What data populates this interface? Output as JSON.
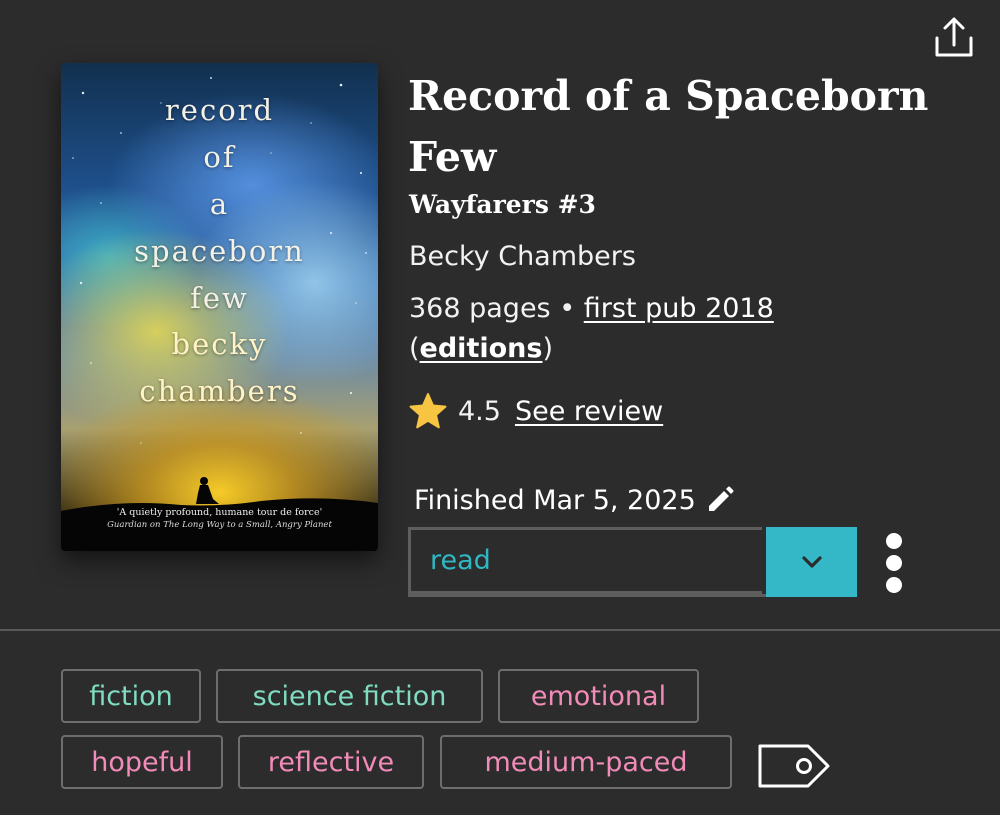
{
  "book": {
    "title": "Record of a Spaceborn Few",
    "series": "Wayfarers #3",
    "author": "Becky Chambers",
    "pages": "368 pages",
    "separator": "•",
    "first_pub": "first pub 2018",
    "editions_open": "(",
    "editions_label": "editions",
    "editions_close": ")"
  },
  "cover": {
    "title_lines": [
      "record",
      "of",
      "a",
      "spaceborn",
      "few"
    ],
    "author_lines": [
      "becky",
      "chambers"
    ],
    "quote": "'A quietly profound, humane tour de force'",
    "credit": "Guardian on The Long Way to a Small, Angry Planet"
  },
  "rating": {
    "value": "4.5",
    "review_label": "See review",
    "star_color": "#f7c542"
  },
  "status": {
    "finished_text": "Finished Mar 5, 2025",
    "selected": "read",
    "accent_color": "#34b7c6"
  },
  "tags": {
    "genres": [
      "fiction",
      "science fiction"
    ],
    "moods": [
      "emotional",
      "hopeful",
      "reflective",
      "medium-paced"
    ],
    "genre_color": "#7fdcc0",
    "mood_color": "#f28bb8"
  },
  "icons": {
    "share": "share-icon",
    "star": "star-icon",
    "edit": "pencil-icon",
    "dropdown": "chevron-down-icon",
    "more": "more-vertical-icon",
    "tag": "tag-icon"
  }
}
